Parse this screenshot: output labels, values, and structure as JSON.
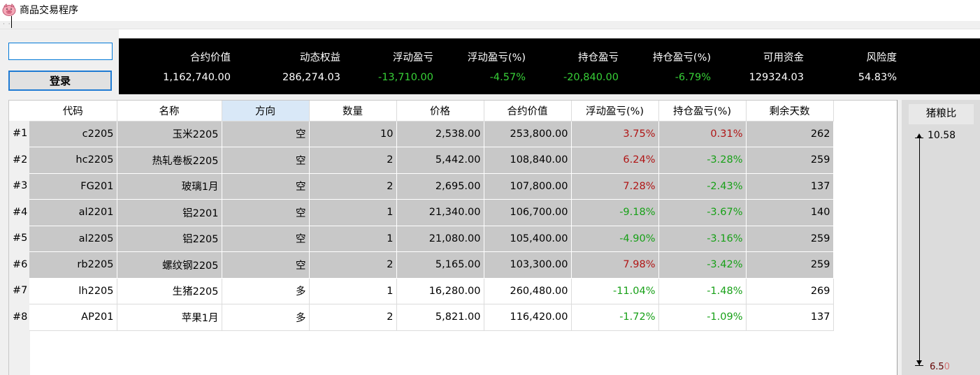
{
  "window": {
    "title": "商品交易程序",
    "icon": "pig-icon"
  },
  "login": {
    "input_value": "",
    "button_label": "登录"
  },
  "summary": {
    "labels": [
      "合约价值",
      "动态权益",
      "浮动盈亏",
      "浮动盈亏(%)",
      "持仓盈亏",
      "持仓盈亏(%)",
      "可用资金",
      "风险度"
    ],
    "values": [
      "1,162,740.00",
      "286,274.03",
      "-13,710.00",
      "-4.57%",
      "-20,840.00",
      "-6.79%",
      "129324.03",
      "54.83%"
    ]
  },
  "table": {
    "headers": [
      "代码",
      "名称",
      "方向",
      "数量",
      "价格",
      "合约价值",
      "浮动盈亏(%)",
      "持仓盈亏(%)",
      "剩余天数"
    ],
    "selected_header": "方向",
    "rows": [
      {
        "num": "#1",
        "code": "c2205",
        "name": "玉米2205",
        "dir": "空",
        "qty": "10",
        "price": "2,538.00",
        "value": "253,800.00",
        "float_pct": "3.75%",
        "hold_pct": "0.31%",
        "days": "262"
      },
      {
        "num": "#2",
        "code": "hc2205",
        "name": "热轧卷板2205",
        "dir": "空",
        "qty": "2",
        "price": "5,442.00",
        "value": "108,840.00",
        "float_pct": "6.24%",
        "hold_pct": "-3.28%",
        "days": "259"
      },
      {
        "num": "#3",
        "code": "FG201",
        "name": "玻璃1月",
        "dir": "空",
        "qty": "2",
        "price": "2,695.00",
        "value": "107,800.00",
        "float_pct": "7.28%",
        "hold_pct": "-2.43%",
        "days": "137"
      },
      {
        "num": "#4",
        "code": "al2201",
        "name": "铝2201",
        "dir": "空",
        "qty": "1",
        "price": "21,340.00",
        "value": "106,700.00",
        "float_pct": "-9.18%",
        "hold_pct": "-3.67%",
        "days": "140"
      },
      {
        "num": "#5",
        "code": "al2205",
        "name": "铝2205",
        "dir": "空",
        "qty": "1",
        "price": "21,080.00",
        "value": "105,400.00",
        "float_pct": "-4.90%",
        "hold_pct": "-3.16%",
        "days": "259"
      },
      {
        "num": "#6",
        "code": "rb2205",
        "name": "螺纹钢2205",
        "dir": "空",
        "qty": "2",
        "price": "5,165.00",
        "value": "103,300.00",
        "float_pct": "7.98%",
        "hold_pct": "-3.42%",
        "days": "259"
      },
      {
        "num": "#7",
        "code": "lh2205",
        "name": "生猪2205",
        "dir": "多",
        "qty": "1",
        "price": "16,280.00",
        "value": "260,480.00",
        "float_pct": "-11.04%",
        "hold_pct": "-1.48%",
        "days": "269"
      },
      {
        "num": "#8",
        "code": "AP201",
        "name": "苹果1月",
        "dir": "多",
        "qty": "2",
        "price": "5,821.00",
        "value": "116,420.00",
        "float_pct": "-1.72%",
        "hold_pct": "-1.09%",
        "days": "137"
      }
    ]
  },
  "gauge": {
    "title": "猪粮比",
    "max": "10.58",
    "min": "6.5",
    "current": "6.50"
  },
  "colors": {
    "positive": "#b01515",
    "negative": "#17a017",
    "summary_bg": "#000000",
    "summary_green": "#37d037"
  }
}
